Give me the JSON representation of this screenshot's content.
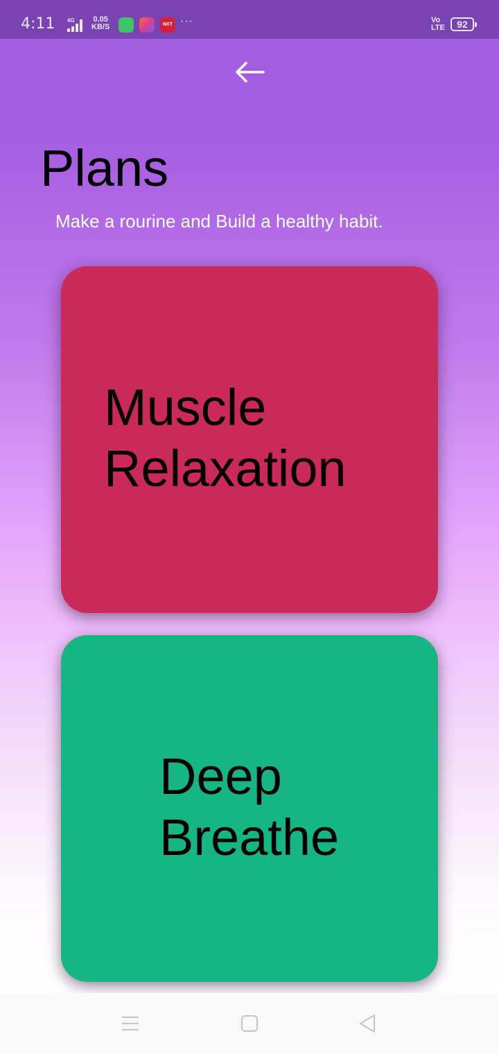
{
  "status_bar": {
    "time": "4:11",
    "network": "4G",
    "speed_value": "0.05",
    "speed_unit": "KB/S",
    "more": "···",
    "volte_top": "Vo",
    "volte_bottom": "LTE",
    "battery": "92",
    "news_icon_text": "NXT"
  },
  "header": {
    "back_icon": "arrow-left-icon"
  },
  "page": {
    "title": "Plans",
    "subtitle": "Make a rourine and Build a healthy habit."
  },
  "plans": [
    {
      "line1": "Muscle",
      "line2": "Relaxation",
      "color": "#ca2a5a"
    },
    {
      "line1": "Deep",
      "line2": "Breathe",
      "color": "#15b684"
    }
  ],
  "nav_bar": {
    "icons": [
      "menu-icon",
      "home-square-icon",
      "back-triangle-icon"
    ]
  }
}
